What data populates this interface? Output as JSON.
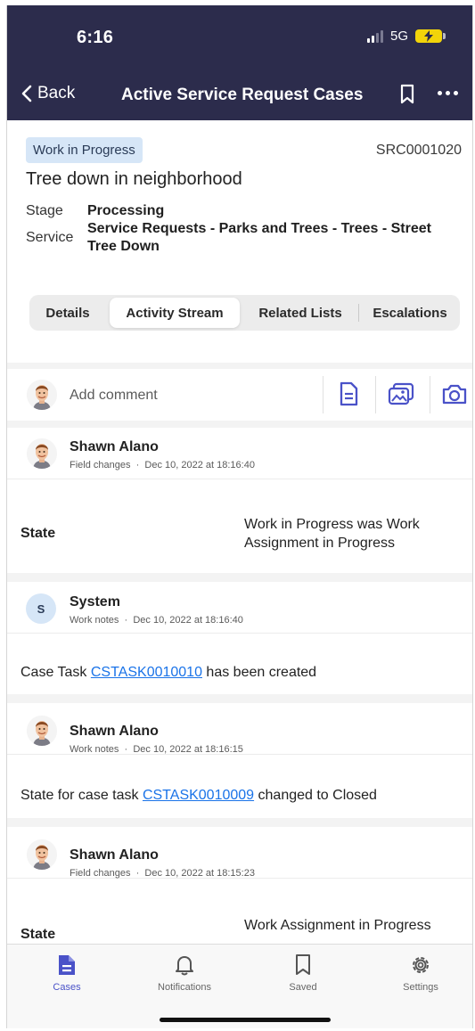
{
  "status_bar": {
    "time": "6:16",
    "network": "5G"
  },
  "nav": {
    "back_label": "Back",
    "title": "Active Service Request Cases",
    "bookmark_icon": "bookmark-icon",
    "more_icon": "more-icon"
  },
  "case": {
    "status_badge": "Work in Progress",
    "number": "SRC0001020",
    "title": "Tree down in neighborhood",
    "stage_label": "Stage",
    "stage_value": "Processing",
    "service_label": "Service",
    "service_value": "Service Requests - Parks and Trees - Trees - Street Tree Down"
  },
  "tabs": [
    {
      "label": "Details",
      "active": false
    },
    {
      "label": "Activity Stream",
      "active": true
    },
    {
      "label": "Related Lists",
      "active": false
    },
    {
      "label": "Escalations",
      "active": false
    }
  ],
  "comment_bar": {
    "placeholder": "Add comment",
    "icons": [
      "document-icon",
      "image-icon",
      "camera-icon"
    ]
  },
  "activity": [
    {
      "author": "Shawn Alano",
      "type": "Field changes",
      "timestamp": "Dec 10, 2022 at 18:16:40",
      "field": "State",
      "value": "Work in Progress was Work Assignment in Progress"
    },
    {
      "author": "System",
      "avatar_initial": "S",
      "type": "Work notes",
      "timestamp": "Dec 10, 2022 at 18:16:40",
      "text_before": "Case Task ",
      "link": "CSTASK0010010",
      "text_after": " has been created"
    },
    {
      "author": "Shawn Alano",
      "type": "Work notes",
      "timestamp": "Dec 10, 2022 at 18:16:15",
      "text_before": "State for case task ",
      "link": "CSTASK0010009",
      "text_after": " changed to Closed"
    },
    {
      "author": "Shawn Alano",
      "type": "Field changes",
      "timestamp": "Dec 10, 2022 at 18:15:23",
      "field": "State",
      "value": "Work Assignment in Progress"
    }
  ],
  "bottom_tabs": [
    {
      "label": "Cases",
      "icon": "cases-icon",
      "active": true
    },
    {
      "label": "Notifications",
      "icon": "bell-icon",
      "active": false
    },
    {
      "label": "Saved",
      "icon": "bookmark-icon",
      "active": false
    },
    {
      "label": "Settings",
      "icon": "gear-icon",
      "active": false
    }
  ],
  "colors": {
    "header_bg": "#2c2c4c",
    "accent": "#4a52c8",
    "link": "#1a73e8",
    "badge_bg": "#d6e6f7"
  }
}
